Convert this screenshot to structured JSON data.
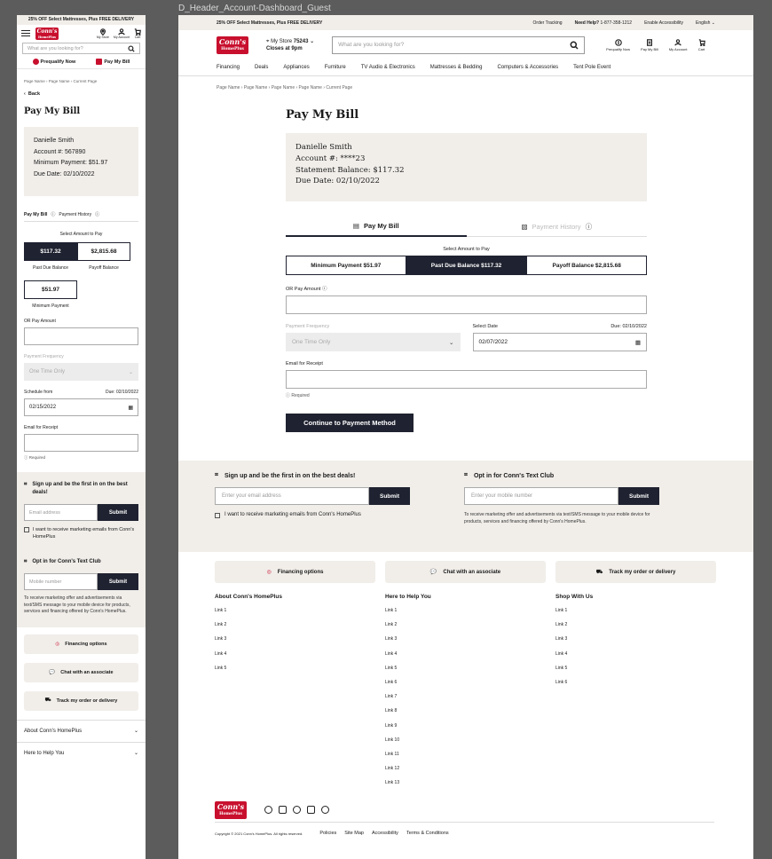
{
  "frame_label": "D_Header_Account-Dashboard_Guest",
  "promo": "25% OFF Select Mattresses, Plus FREE DELIVERY",
  "brand": {
    "logo_top": "Conn's",
    "logo_bottom": "HomePlus",
    "red": "#c8102e",
    "navy": "#1f2230",
    "beige": "#f1eeea"
  },
  "header": {
    "order_tracking": "Order Tracking",
    "need_help": "Need Help?",
    "phone": "1-877-358-1212",
    "accessibility": "Enable Accessibility",
    "language": "English ⌄",
    "store_label": "My Store",
    "store_num": "75243 ⌄",
    "store_hours": "Closes at 9pm",
    "search_placeholder": "What are you looking for?",
    "icons": [
      "Prequalify Now",
      "Pay My Bill",
      "My Account",
      "Cart"
    ],
    "mobile_icons": [
      "My Store",
      "My Account",
      "Cart"
    ]
  },
  "nav": [
    "Financing",
    "Deals",
    "Appliances",
    "Furniture",
    "TV Audio & Electronics",
    "Mattresses & Bedding",
    "Computers & Accessories",
    "Tent Pole Event"
  ],
  "mobile_quick": {
    "prequalify": "Prequalify Now",
    "pay": "Pay My Bill"
  },
  "breadcrumb_mobile": "Page Name  ›  Page Name  ›  Current Page",
  "breadcrumb_desktop": "Page Name  ›  Page Name  ›  Page Name  ›  Page Name  ›  Current Page",
  "back": "Back",
  "title": "Pay My Bill",
  "account": {
    "name": "Danielle Smith",
    "mobile_account": "Account #: 567890",
    "mobile_min": "Minimum Payment: $51.97",
    "mobile_due": "Due Date: 02/10/2022",
    "desk_account": "Account #: ****23",
    "desk_balance": "Statement Balance: $117.32",
    "desk_due": "Due Date: 02/10/2022"
  },
  "tabs": {
    "pay": "Pay My Bill",
    "history": "Payment History"
  },
  "select_label": "Select Amount to Pay",
  "mobile_amounts": [
    {
      "value": "$117.32",
      "caption": "Past Due Balance"
    },
    {
      "value": "$2,815.68",
      "caption": "Payoff Balance"
    },
    {
      "value": "$51.97",
      "caption": "Minimum Payment"
    }
  ],
  "desk_amounts": [
    "Minimum Payment $51.97",
    "Past Due Balance $117.32",
    "Payoff Balance $2,815.68"
  ],
  "form": {
    "or_pay": "OR Pay Amount",
    "frequency_label": "Payment Frequency",
    "frequency_value": "One Time Only",
    "mobile_date_label": "Schedule from",
    "desk_date_label": "Select Date",
    "due": "Due: 02/10/2022",
    "mobile_date": "02/15/2022",
    "desk_date": "02/07/2022",
    "email_label": "Email for Receipt",
    "required": "Required",
    "cta": "Continue to Payment Method"
  },
  "signup": {
    "heading": "Sign up and be the first in on the best deals!",
    "email_placeholder": "Enter your email address",
    "mobile_email_placeholder": "Email address",
    "submit": "Submit",
    "checkbox": "I want to receive marketing emails from Conn's HomePlus",
    "text_heading": "Opt in for Conn's Text Club",
    "mobile_placeholder": "Enter your mobile number",
    "mobile_mobile_placeholder": "Mobile number",
    "fine": "To receive marketing offer and advertisements via text/SMS message to your mobile device for products, services and financing offered by Conn's HomePlus."
  },
  "actions": [
    "Financing options",
    "Chat with an associate",
    "Track my order or delivery"
  ],
  "footer": {
    "cols": [
      {
        "title": "About Conn's HomePlus",
        "links": [
          "Link 1",
          "Link 2",
          "Link 3",
          "Link 4",
          "Link 5"
        ]
      },
      {
        "title": "Here to Help You",
        "links": [
          "Link 1",
          "Link 2",
          "Link 3",
          "Link 4",
          "Link 5",
          "Link 6",
          "Link 7",
          "Link 8",
          "Link 9",
          "Link 10",
          "Link 11",
          "Link 12",
          "Link 13"
        ]
      },
      {
        "title": "Shop With Us",
        "links": [
          "Link 1",
          "Link 2",
          "Link 3",
          "Link 4",
          "Link 5",
          "Link 6"
        ]
      }
    ],
    "copyright": "Copyright © 2021 Conn's HomePlus. All rights reserved.",
    "legal": [
      "Policies",
      "Site Map",
      "Accessibility",
      "Terms & Conditions"
    ],
    "mobile_accordion": [
      "About Conn's HomePlus",
      "Here to Help You"
    ]
  }
}
